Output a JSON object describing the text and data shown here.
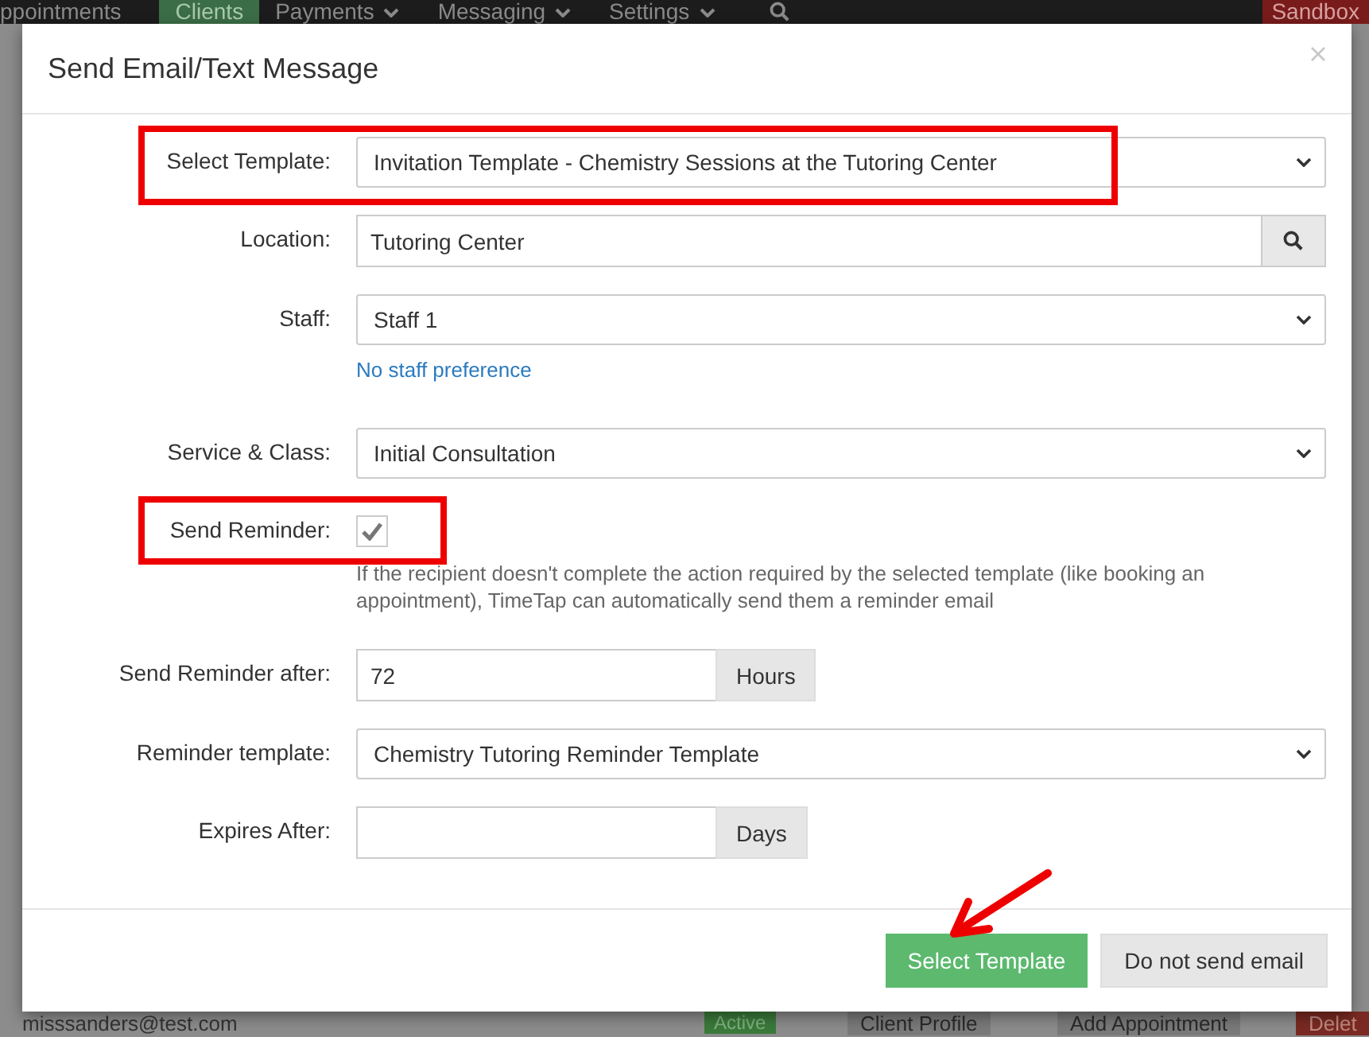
{
  "nav": {
    "items": [
      {
        "label": "ppointments",
        "selected": false
      },
      {
        "label": "Clients",
        "selected": true
      },
      {
        "label": "Payments",
        "selected": false,
        "dropdown": true
      },
      {
        "label": "Messaging",
        "selected": false,
        "dropdown": true
      },
      {
        "label": "Settings",
        "selected": false,
        "dropdown": true
      }
    ],
    "badge": "Sandbox"
  },
  "background_row": {
    "email": "misssanders@test.com",
    "status": "Active",
    "buttons": [
      "Client Profile",
      "Add Appointment",
      "Delet"
    ]
  },
  "modal": {
    "title": "Send Email/Text Message",
    "fields": [
      {
        "kind": "select",
        "label": "Select Template:",
        "value": "Invitation Template - Chemistry Sessions at the Tutoring Center"
      },
      {
        "kind": "search",
        "label": "Location:",
        "value": "Tutoring Center"
      },
      {
        "kind": "select",
        "label": "Staff:",
        "value": "Staff 1",
        "link": "No staff preference"
      },
      {
        "kind": "select",
        "label": "Service & Class:",
        "value": "Initial Consultation"
      },
      {
        "kind": "checkbox",
        "label": "Send Reminder:",
        "checked": true,
        "help": "If the recipient doesn't complete the action required by the selected template (like booking an appointment), TimeTap can automatically send them a reminder email"
      },
      {
        "kind": "addon",
        "label": "Send Reminder after:",
        "value": "72",
        "addon": "Hours"
      },
      {
        "kind": "select",
        "label": "Reminder template:",
        "value": "Chemistry Tutoring Reminder Template"
      },
      {
        "kind": "addon",
        "label": "Expires After:",
        "addon": "Days"
      }
    ],
    "primary_button": "Select Template",
    "secondary_button": "Do not send email"
  }
}
